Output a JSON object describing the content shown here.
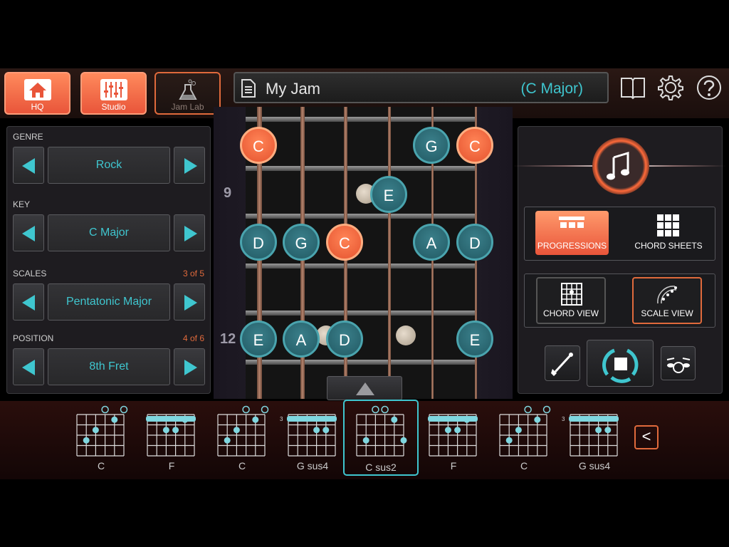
{
  "nav": {
    "hq_label": "HQ",
    "studio_label": "Studio",
    "jamlab_label": "Jam Lab"
  },
  "header": {
    "jam_name": "My Jam",
    "jam_key": "(C Major)"
  },
  "settings": {
    "genre": {
      "label": "GENRE",
      "value": "Rock"
    },
    "key": {
      "label": "KEY",
      "value": "C Major"
    },
    "scales": {
      "label": "SCALES",
      "count": "3 of 5",
      "value": "Pentatonic Major"
    },
    "position": {
      "label": "POSITION",
      "count": "4 of 6",
      "value": "8th Fret"
    }
  },
  "fretboard": {
    "fret_numbers": [
      "9",
      "12"
    ],
    "notes": [
      "C",
      "G",
      "C",
      "E",
      "D",
      "G",
      "C",
      "A",
      "D",
      "E",
      "A",
      "D",
      "E"
    ]
  },
  "right_panel": {
    "progressions_label": "PROGRESSIONS",
    "chord_sheets_label": "CHORD SHEETS",
    "chord_view_label": "CHORD VIEW",
    "scale_view_label": "SCALE VIEW"
  },
  "chords": [
    {
      "name": "C"
    },
    {
      "name": "F"
    },
    {
      "name": "C"
    },
    {
      "name": "G sus4",
      "fret": "3"
    },
    {
      "name": "C sus2"
    },
    {
      "name": "F"
    },
    {
      "name": "C"
    },
    {
      "name": "G sus4",
      "fret": "3"
    }
  ],
  "back_label": "<",
  "colors": {
    "accent_teal": "#3fc6cf",
    "accent_orange": "#e9553a",
    "note_teal": "#2d6f78",
    "note_orange": "#ff7043"
  }
}
